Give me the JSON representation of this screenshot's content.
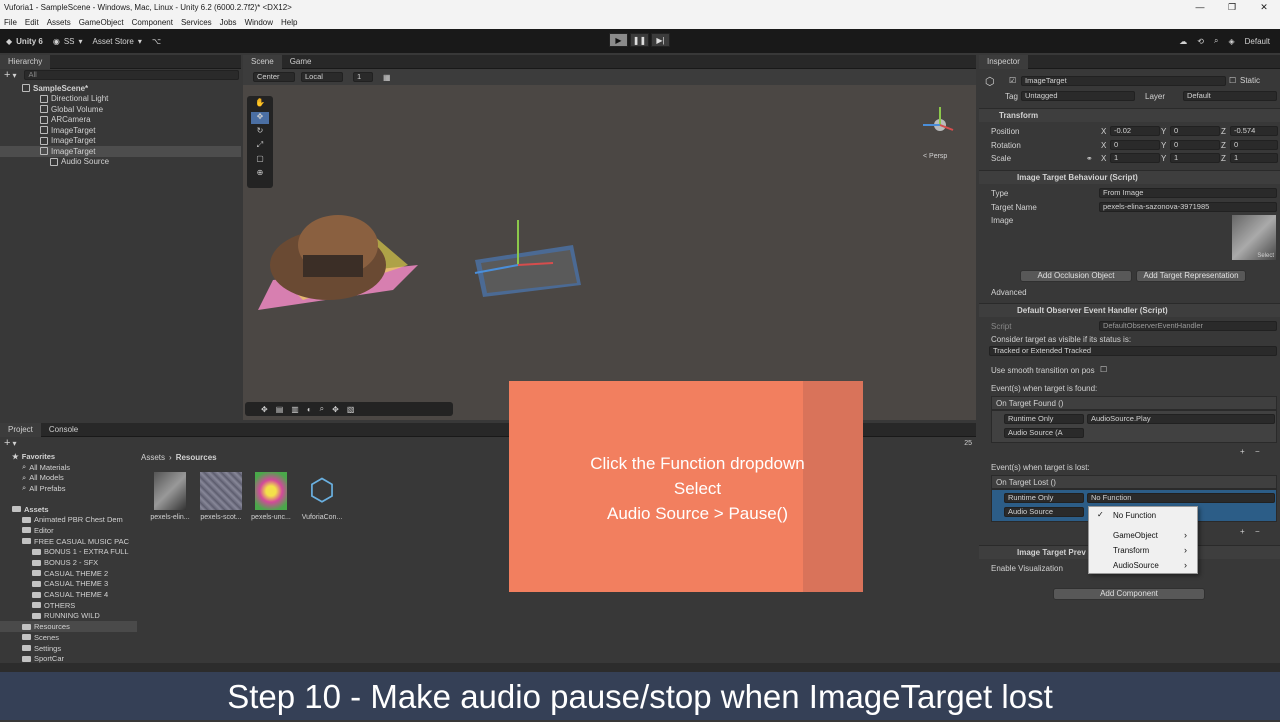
{
  "window": {
    "title": "Vuforia1 - SampleScene - Windows, Mac, Linux - Unity 6.2 (6000.2.7f2)* <DX12>"
  },
  "menubar": [
    "File",
    "Edit",
    "Assets",
    "GameObject",
    "Component",
    "Services",
    "Jobs",
    "Window",
    "Help"
  ],
  "toolbar": {
    "unity_label": "Unity 6",
    "account": "SS",
    "asset_store": "Asset Store",
    "layout": "Default"
  },
  "hierarchy": {
    "tab": "Hierarchy",
    "search_placeholder": "All",
    "items": [
      {
        "label": "SampleScene*"
      },
      {
        "label": "Directional Light"
      },
      {
        "label": "Global Volume"
      },
      {
        "label": "ARCamera"
      },
      {
        "label": "ImageTarget"
      },
      {
        "label": "ImageTarget"
      },
      {
        "label": "ImageTarget"
      },
      {
        "label": "Audio Source"
      }
    ]
  },
  "scene": {
    "tabs": [
      "Scene",
      "Game"
    ],
    "pivot": "Center",
    "space": "Local",
    "snap": "1",
    "persp_label": "< Persp"
  },
  "project": {
    "tabs": [
      "Project",
      "Console"
    ],
    "favorites": {
      "label": "Favorites",
      "items": [
        "All Materials",
        "All Models",
        "All Prefabs"
      ]
    },
    "assets_label": "Assets",
    "folders": [
      "Animated PBR Chest Dem",
      "Editor",
      "FREE CASUAL MUSIC PAC",
      "BONUS 1 - EXTRA FULL",
      "BONUS 2 - SFX",
      "CASUAL THEME 2",
      "CASUAL THEME 3",
      "CASUAL THEME 4",
      "OTHERS",
      "RUNNING WILD",
      "Resources",
      "Scenes",
      "Settings",
      "SportCar"
    ],
    "breadcrumb": [
      "Assets",
      "Resources"
    ],
    "assets": [
      {
        "label": "pexels-elin..."
      },
      {
        "label": "pexels-scot..."
      },
      {
        "label": "pexels-unc..."
      },
      {
        "label": "VuforiaCon..."
      }
    ],
    "count": "25"
  },
  "inspector": {
    "tab": "Inspector",
    "object_name": "ImageTarget",
    "static_label": "Static",
    "tag_label": "Tag",
    "tag_value": "Untagged",
    "layer_label": "Layer",
    "layer_value": "Default",
    "transform": {
      "title": "Transform",
      "position_label": "Position",
      "rotation_label": "Rotation",
      "scale_label": "Scale",
      "position": {
        "x": "-0.02",
        "y": "0",
        "z": "-0.574"
      },
      "rotation": {
        "x": "0",
        "y": "0",
        "z": "0"
      },
      "scale": {
        "x": "1",
        "y": "1",
        "z": "1"
      }
    },
    "itb": {
      "title": "Image Target Behaviour (Script)",
      "type_label": "Type",
      "type_value": "From Image",
      "target_name_label": "Target Name",
      "target_name_value": "pexels-elina-sazonova-3971985",
      "image_label": "Image",
      "select_label": "Select",
      "add_occlusion": "Add Occlusion Object",
      "add_representation": "Add Target Representation",
      "advanced": "Advanced"
    },
    "doeh": {
      "title": "Default Observer Event Handler (Script)",
      "script_label": "Script",
      "script_value": "DefaultObserverEventHandler",
      "consider_label": "Consider target as visible if its status is:",
      "consider_value": "Tracked or Extended Tracked",
      "smooth_label": "Use smooth transition on pos",
      "found_label": "Event(s) when target is found:",
      "found_event": "On Target Found ()",
      "found_runtime": "Runtime Only",
      "found_function": "AudioSource.Play",
      "found_object": "Audio Source (A",
      "lost_label": "Event(s) when target is lost:",
      "lost_event": "On Target Lost ()",
      "lost_runtime": "Runtime Only",
      "lost_function": "No Function",
      "lost_object": "Audio Source"
    },
    "preview": {
      "title": "Image Target Prev",
      "enable_label": "Enable Visualization"
    },
    "add_component": "Add Component"
  },
  "function_menu": {
    "items": [
      {
        "label": "No Function",
        "checked": true
      },
      {
        "label": "GameObject",
        "submenu": true
      },
      {
        "label": "Transform",
        "submenu": true
      },
      {
        "label": "AudioSource",
        "submenu": true
      }
    ]
  },
  "overlay": {
    "lines": [
      "Click the Function dropdown",
      "Select",
      "Audio Source > Pause()"
    ],
    "color": "#f27f5f"
  },
  "caption": "Step 10 - Make audio pause/stop when ImageTarget lost"
}
